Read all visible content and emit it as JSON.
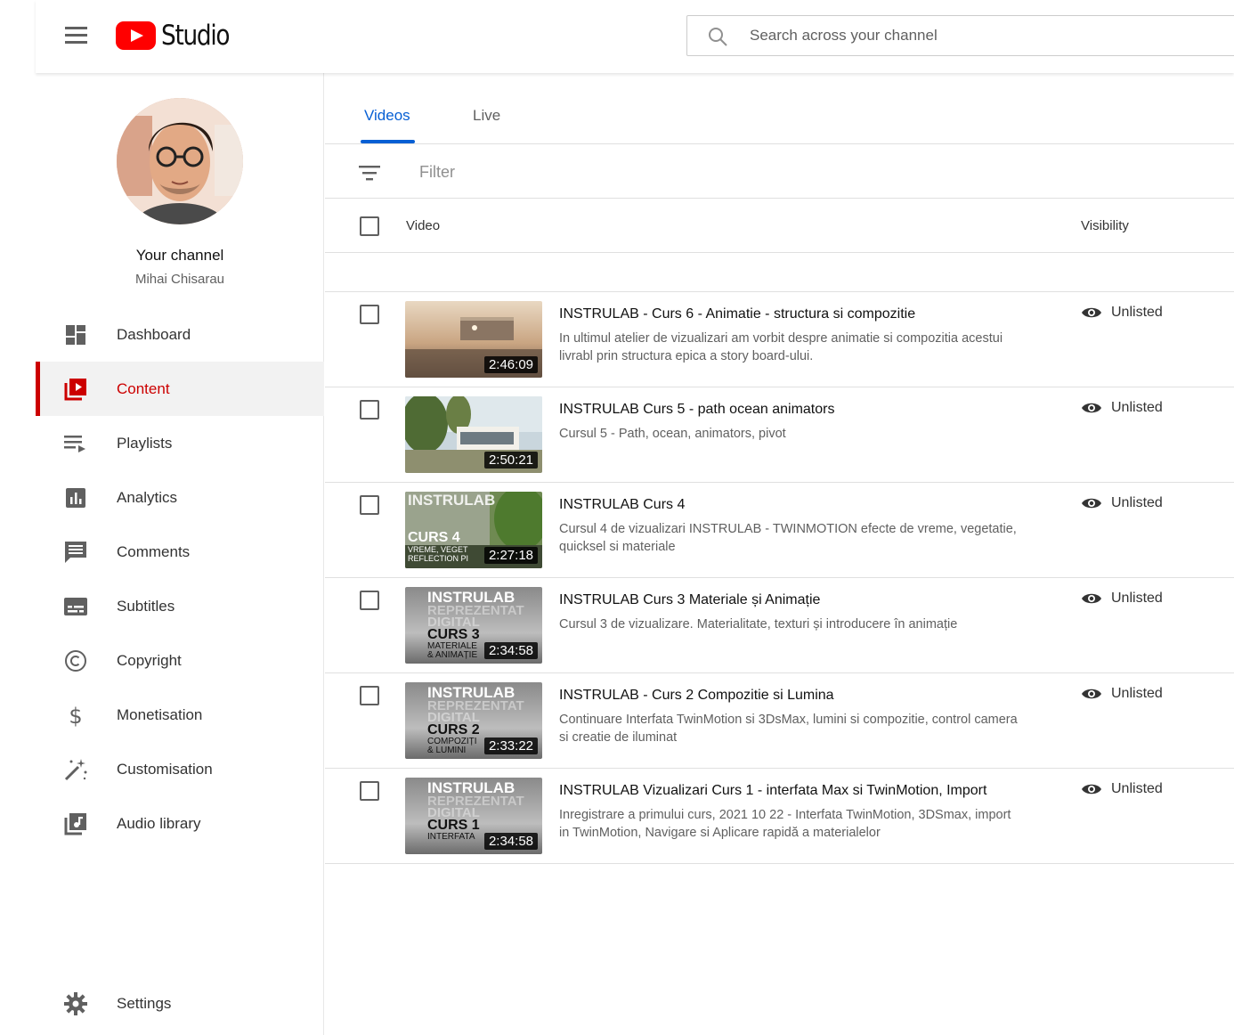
{
  "header": {
    "logo_text": "Studio",
    "search_placeholder": "Search across your channel"
  },
  "sidebar": {
    "channel_label": "Your channel",
    "channel_name": "Mihai Chisarau",
    "items": [
      {
        "label": "Dashboard",
        "icon": "dashboard-icon"
      },
      {
        "label": "Content",
        "icon": "content-icon",
        "active": true
      },
      {
        "label": "Playlists",
        "icon": "playlists-icon"
      },
      {
        "label": "Analytics",
        "icon": "analytics-icon"
      },
      {
        "label": "Comments",
        "icon": "comments-icon"
      },
      {
        "label": "Subtitles",
        "icon": "subtitles-icon"
      },
      {
        "label": "Copyright",
        "icon": "copyright-icon"
      },
      {
        "label": "Monetisation",
        "icon": "dollar-icon"
      },
      {
        "label": "Customisation",
        "icon": "magic-wand-icon"
      },
      {
        "label": "Audio library",
        "icon": "audio-library-icon"
      }
    ],
    "settings_label": "Settings"
  },
  "main": {
    "tabs": [
      {
        "label": "Videos",
        "active": true
      },
      {
        "label": "Live"
      }
    ],
    "filter_placeholder": "Filter",
    "columns": {
      "video": "Video",
      "visibility": "Visibility"
    },
    "videos": [
      {
        "title": "INSTRULAB - Curs 6 - Animatie - structura si compozitie",
        "description": "In ultimul atelier de vizualizari am vorbit despre animatie si compozitia acestui livrabl prin structura epica a story board-ului.",
        "duration": "2:46:09",
        "visibility": "Unlisted"
      },
      {
        "title": "INSTRULAB Curs 5 - path ocean animators",
        "description": "Cursul 5 - Path, ocean, animators, pivot",
        "duration": "2:50:21",
        "visibility": "Unlisted"
      },
      {
        "title": "INSTRULAB Curs 4",
        "description": "Cursul 4 de vizualizari INSTRULAB - TWINMOTION efecte de vreme, vegetatie, quicksel si materiale",
        "duration": "2:27:18",
        "visibility": "Unlisted",
        "thumb_lines": [
          "INSTRULAB",
          "CURS 4",
          "VREME, VEGET",
          "REFLECTION PI"
        ]
      },
      {
        "title": "INSTRULAB Curs 3 Materiale și Animație",
        "description": "Cursul 3 de vizualizare. Materialitate, texturi și introducere în animație",
        "duration": "2:34:58",
        "visibility": "Unlisted",
        "thumb_lines": [
          "INSTRULAB",
          "REPREZENTAT",
          "DIGITAL",
          "CURS 3",
          "MATERIALE",
          "& ANIMAȚIE"
        ]
      },
      {
        "title": "INSTRULAB - Curs 2 Compozitie si Lumina",
        "description": "Continuare Interfata TwinMotion si 3DsMax, lumini si compozitie, control camera si creatie de iluminat",
        "duration": "2:33:22",
        "visibility": "Unlisted",
        "thumb_lines": [
          "INSTRULAB",
          "REPREZENTAT",
          "DIGITAL",
          "CURS 2",
          "COMPOZIȚI",
          "& LUMINI"
        ]
      },
      {
        "title": "INSTRULAB Vizualizari Curs 1 - interfata Max si TwinMotion, Import",
        "description": "Inregistrare a primului curs, 2021 10 22 - Interfata TwinMotion, 3DSmax, import in TwinMotion, Navigare si Aplicare rapidă a materialelor",
        "duration": "2:34:58",
        "visibility": "Unlisted",
        "thumb_lines": [
          "INSTRULAB",
          "REPREZENTAT",
          "DIGITAL",
          "CURS 1",
          "INTERFATA"
        ]
      }
    ]
  },
  "colors": {
    "brand_red": "#ff0000",
    "active_red": "#cc0000",
    "tab_blue": "#065fd4"
  }
}
